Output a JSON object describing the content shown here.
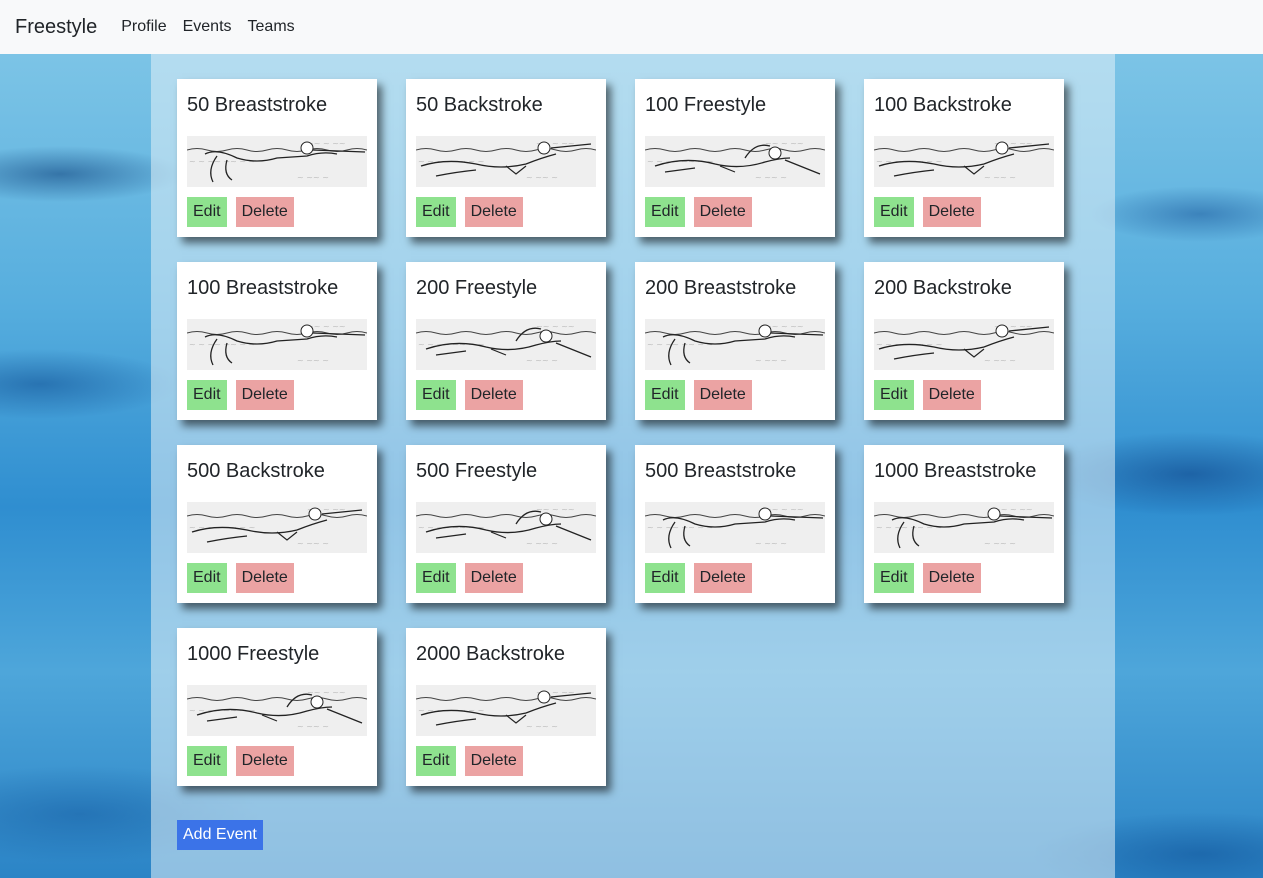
{
  "nav": {
    "brand": "Freestyle",
    "links": [
      "Profile",
      "Events",
      "Teams"
    ]
  },
  "events": [
    {
      "title": "50 Breaststroke",
      "stroke": "breaststroke"
    },
    {
      "title": "50 Backstroke",
      "stroke": "backstroke"
    },
    {
      "title": "100 Freestyle",
      "stroke": "freestyle"
    },
    {
      "title": "100 Backstroke",
      "stroke": "backstroke"
    },
    {
      "title": "100 Breaststroke",
      "stroke": "breaststroke"
    },
    {
      "title": "200 Freestyle",
      "stroke": "freestyle"
    },
    {
      "title": "200 Breaststroke",
      "stroke": "breaststroke"
    },
    {
      "title": "200 Backstroke",
      "stroke": "backstroke"
    },
    {
      "title": "500 Backstroke",
      "stroke": "backstroke"
    },
    {
      "title": "500 Freestyle",
      "stroke": "freestyle"
    },
    {
      "title": "500 Breaststroke",
      "stroke": "breaststroke"
    },
    {
      "title": "1000 Breaststroke",
      "stroke": "breaststroke"
    },
    {
      "title": "1000 Freestyle",
      "stroke": "freestyle"
    },
    {
      "title": "2000 Backstroke",
      "stroke": "backstroke"
    }
  ],
  "buttons": {
    "edit_label": "Edit",
    "delete_label": "Delete",
    "add_label": "Add Event"
  },
  "colors": {
    "edit": "#8ee28e",
    "delete": "#eba3a3",
    "add": "#3b73e8"
  }
}
